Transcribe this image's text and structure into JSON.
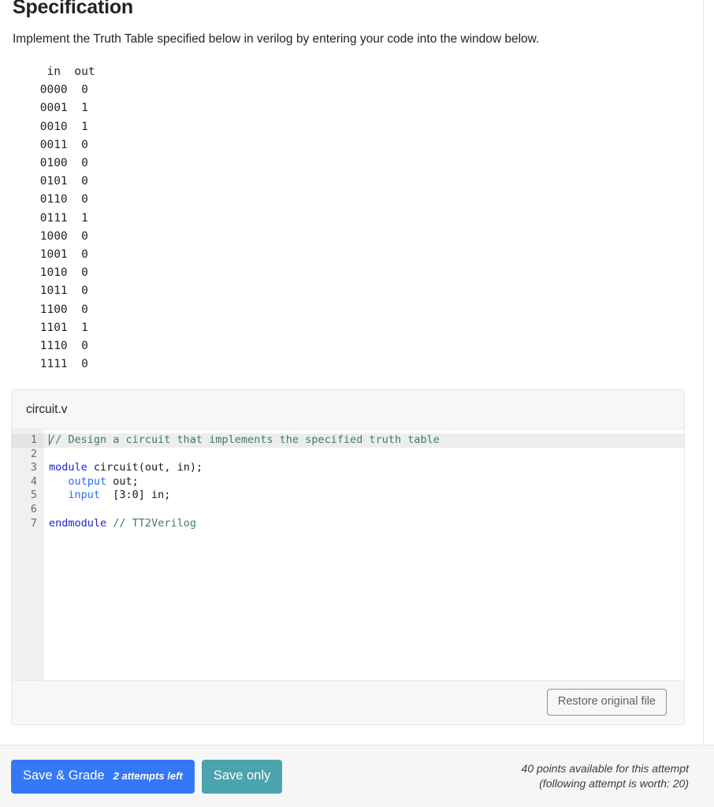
{
  "page": {
    "title": "Specification",
    "instructions": "Implement the Truth Table specified below in verilog by entering your code into the window below."
  },
  "truth_table": {
    "headers": [
      "in",
      "out"
    ],
    "rows": [
      [
        "0000",
        "0"
      ],
      [
        "0001",
        "1"
      ],
      [
        "0010",
        "1"
      ],
      [
        "0011",
        "0"
      ],
      [
        "0100",
        "0"
      ],
      [
        "0101",
        "0"
      ],
      [
        "0110",
        "0"
      ],
      [
        "0111",
        "1"
      ],
      [
        "1000",
        "0"
      ],
      [
        "1001",
        "0"
      ],
      [
        "1010",
        "0"
      ],
      [
        "1011",
        "0"
      ],
      [
        "1100",
        "0"
      ],
      [
        "1101",
        "1"
      ],
      [
        "1110",
        "0"
      ],
      [
        "1111",
        "0"
      ]
    ],
    "text": "  in  out\n 0000  0\n 0001  1\n 0010  1\n 0011  0\n 0100  0\n 0101  0\n 0110  0\n 0111  1\n 1000  0\n 1001  0\n 1010  0\n 1011  0\n 1100  0\n 1101  1\n 1110  0\n 1111  0"
  },
  "editor": {
    "filename": "circuit.v",
    "line_numbers": [
      "1",
      "2",
      "3",
      "4",
      "5",
      "6",
      "7"
    ],
    "active_line": 1,
    "code_lines": [
      "// Design a circuit that implements the specified truth table",
      "",
      "module circuit(out, in);",
      "   output out;",
      "   input  [3:0] in;",
      "",
      "endmodule // TT2Verilog"
    ],
    "restore_button": "Restore original file"
  },
  "actions": {
    "save_grade_label": "Save & Grade",
    "attempts_left": "2 attempts left",
    "save_only_label": "Save only",
    "points_line1": "40 points available for this attempt",
    "points_line2": "(following attempt is worth: 20)"
  },
  "colors": {
    "primary": "#3478f6",
    "secondary": "#4aa3ad",
    "comment": "#3f7f5f",
    "keyword": "#2222cc",
    "type": "#2b6ef5"
  }
}
